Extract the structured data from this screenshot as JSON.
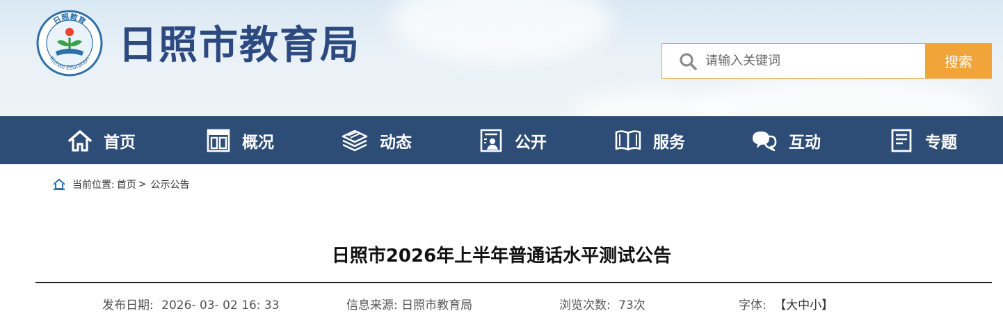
{
  "header": {
    "site_title": "日照市教育局",
    "logo": {
      "top_text": "日照教育",
      "bottom_text": "Rizhao Education"
    },
    "search": {
      "placeholder": "请输入关键词",
      "button_label": "搜索"
    }
  },
  "nav": {
    "items": [
      {
        "label": "首页",
        "icon": "home-icon"
      },
      {
        "label": "概况",
        "icon": "overview-icon"
      },
      {
        "label": "动态",
        "icon": "news-stack-icon"
      },
      {
        "label": "公开",
        "icon": "disclosure-icon"
      },
      {
        "label": "服务",
        "icon": "book-icon"
      },
      {
        "label": "互动",
        "icon": "chat-bubbles-icon"
      },
      {
        "label": "专题",
        "icon": "document-icon"
      }
    ]
  },
  "breadcrumb": {
    "prefix": "当前位置:",
    "home": "首页",
    "separator": ">",
    "current": "公示公告"
  },
  "article": {
    "title": "日照市2026年上半年普通话水平测试公告",
    "publish_date_label": "发布日期:",
    "publish_date": "2026- 03- 02 16: 33",
    "source_label": "信息来源:",
    "source": "日照市教育局",
    "views_label": "浏览次数:",
    "views": "73次",
    "font_label": "字体:",
    "font_open": "【",
    "font_large": "大",
    "font_medium": "中",
    "font_small": "小",
    "font_close": "】"
  },
  "colors": {
    "nav_bg": "#2d4d77",
    "title_blue": "#2d4a80",
    "accent_orange": "#f0a43a"
  }
}
